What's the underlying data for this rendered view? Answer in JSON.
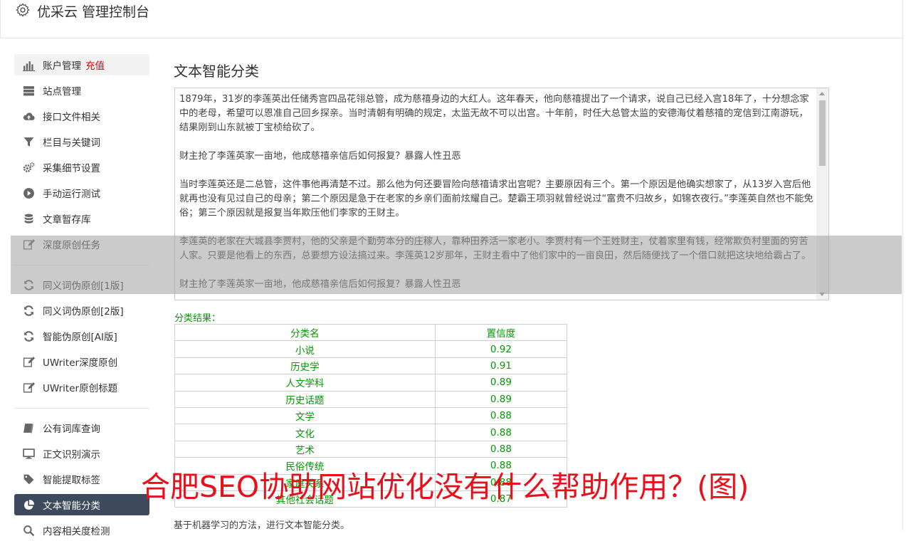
{
  "header": {
    "title": "优采云 管理控制台",
    "icon": "gear-icon"
  },
  "sidebar": {
    "items": [
      {
        "label": "账户管理",
        "badge": "充值",
        "icon": "bar-chart-icon"
      },
      {
        "label": "站点管理",
        "icon": "server-icon"
      },
      {
        "label": "接口文件相关",
        "icon": "cloud-upload-icon"
      },
      {
        "label": "栏目与关键词",
        "icon": "filter-icon"
      },
      {
        "label": "采集细节设置",
        "icon": "cogs-icon"
      },
      {
        "label": "手动运行测试",
        "icon": "play-circle-icon"
      },
      {
        "label": "文章暂存库",
        "icon": "database-icon"
      },
      {
        "label": "深度原创任务",
        "icon": "edit-icon"
      },
      {
        "label": "同义词伪原创[1版]",
        "icon": "refresh-icon"
      },
      {
        "label": "同义词伪原创[2版]",
        "icon": "refresh-icon"
      },
      {
        "label": "智能伪原创[AI版]",
        "icon": "refresh-icon"
      },
      {
        "label": "UWriter深度原创",
        "icon": "edit-icon"
      },
      {
        "label": "UWriter原创标题",
        "icon": "edit-icon"
      },
      {
        "label": "公有词库查询",
        "icon": "book-icon"
      },
      {
        "label": "正文识别演示",
        "icon": "monitor-icon"
      },
      {
        "label": "智能提取标签",
        "icon": "tag-icon"
      },
      {
        "label": "文本智能分类",
        "icon": "pie-chart-icon"
      },
      {
        "label": "内容相关度检测",
        "icon": "search-icon"
      }
    ]
  },
  "main": {
    "title": "文本智能分类",
    "input_text": [
      "1879年，31岁的李莲英出任储秀宫四品花翎总管，成为慈禧身边的大红人。这年春天，他向慈禧提出了一个请求，说自己已经入宫18年了，十分想念家中的老母，希望可以恩准自己回乡探亲。当时清朝有明确的规定，太监无故不可以出宫。十年前，时任大总管太监的安德海仗着慈禧的宠信到江南游玩，结果刚到山东就被丁宝桢给砍了。",
      "财主抢了李莲英家一亩地，他成慈禧亲信后如何报复？暴露人性丑恶",
      "当时李莲英还是二总管，这件事他再清楚不过。那么他为何还要冒险向慈禧请求出宫呢？主要原因有三个。第一个原因是他确实想家了，从13岁入宫后他就再也没有见过自己的母亲；第二个原因是急于在老家的乡亲们面前炫耀自己。楚霸王项羽就曾经说过“富贵不归故乡，如锦衣夜行。”李莲英自然也不能免俗；第三个原因就是报复当年欺压他们李家的王财主。",
      "李莲英的老家在大城县李贾村，他的父亲是个勤劳本分的庄稼人，靠种田养活一家老小。李贾村有一个王姓财主，仗着家里有钱，经常欺负村里面的穷苦人家。只要是他看上的东西，总要想方设法搞过来。李莲英12岁那年，王财主看中了他们家中的一亩良田，然后随便找了一个借口就把这块地给霸占了。",
      "财主抢了李莲英家一亩地，他成慈禧亲信后如何报复？暴露人性丑恶"
    ],
    "result_label": "分类结果：",
    "table": {
      "headers": [
        "分类名",
        "置信度"
      ],
      "rows": [
        [
          "小说",
          "0.92"
        ],
        [
          "历史学",
          "0.91"
        ],
        [
          "人文学科",
          "0.89"
        ],
        [
          "历史话题",
          "0.89"
        ],
        [
          "文学",
          "0.88"
        ],
        [
          "文化",
          "0.88"
        ],
        [
          "艺术",
          "0.88"
        ],
        [
          "民俗传统",
          "0.88"
        ],
        [
          "家庭关系",
          "0.88"
        ],
        [
          "其他社会话题",
          "0.87"
        ]
      ]
    },
    "footnote": "基于机器学习的方法，进行文本智能分类。"
  },
  "watermark": "合肥SEO协助网站优化没有什么帮助作用？(图)",
  "colors": {
    "active_bg": "#3d4a5d",
    "result_green": "#009900",
    "charge_red": "#e60000",
    "watermark_red": "#e8101b"
  }
}
